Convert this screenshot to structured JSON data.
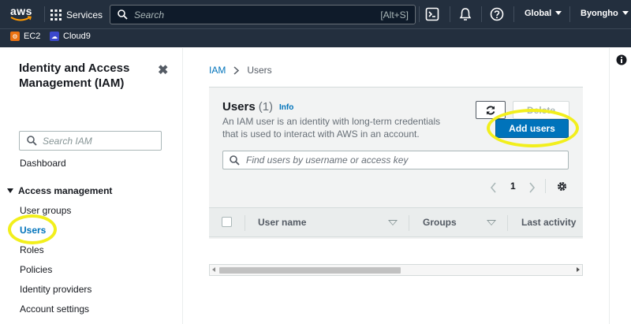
{
  "topnav": {
    "logo": "aws",
    "services_label": "Services",
    "search_placeholder": "Search",
    "search_shortcut": "[Alt+S]",
    "region": "Global",
    "user": "Byongho",
    "icons": [
      "cloudshell-icon",
      "bell-icon",
      "help-icon"
    ]
  },
  "favorites": [
    {
      "label": "EC2",
      "color": "#ec7211"
    },
    {
      "label": "Cloud9",
      "color": "#3b48cc"
    }
  ],
  "sidebar": {
    "title": "Identity and Access Management (IAM)",
    "search_placeholder": "Search IAM",
    "dashboard": "Dashboard",
    "section": "Access management",
    "items": [
      "User groups",
      "Users",
      "Roles",
      "Policies",
      "Identity providers",
      "Account settings"
    ],
    "active_item": "Users"
  },
  "breadcrumb": {
    "root": "IAM",
    "current": "Users"
  },
  "users_panel": {
    "title": "Users",
    "count": "(1)",
    "info": "Info",
    "description": "An IAM user is an identity with long-term credentials that is used to interact with AWS in an account.",
    "delete_label": "Delete",
    "add_label": "Add users",
    "filter_placeholder": "Find users by username or access key",
    "page": "1"
  },
  "table": {
    "columns": [
      "User name",
      "Groups",
      "Last activity"
    ]
  },
  "colors": {
    "nav_bg": "#232f3e",
    "accent": "#0073bb",
    "highlight": "#f2ef1c"
  }
}
